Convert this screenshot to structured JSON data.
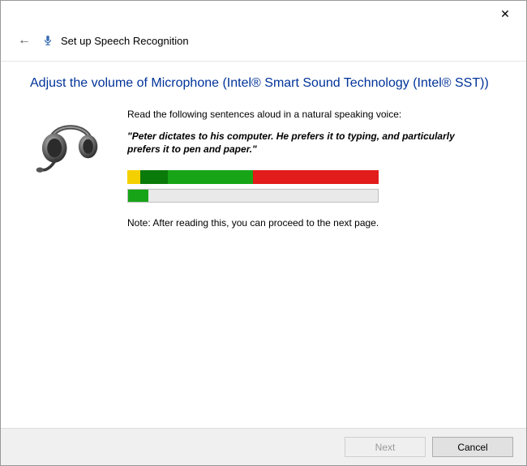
{
  "window": {
    "title": "Set up Speech Recognition",
    "close_glyph": "✕",
    "back_glyph": "←"
  },
  "page": {
    "heading": "Adjust the volume of Microphone (Intel® Smart Sound Technology (Intel® SST))",
    "instruction": "Read the following sentences aloud in a natural speaking voice:",
    "sentence": "\"Peter dictates to his computer. He prefers it to typing, and particularly prefers it to pen and paper.\"",
    "note": "Note: After reading this, you can proceed to the next page."
  },
  "meter": {
    "range_segments": [
      {
        "color": "yellow",
        "pct": 5
      },
      {
        "color": "dgreen",
        "pct": 11
      },
      {
        "color": "green",
        "pct": 34
      },
      {
        "color": "red",
        "pct": 50
      }
    ],
    "live_level_pct": 8
  },
  "footer": {
    "next_label": "Next",
    "next_enabled": false,
    "cancel_label": "Cancel"
  }
}
